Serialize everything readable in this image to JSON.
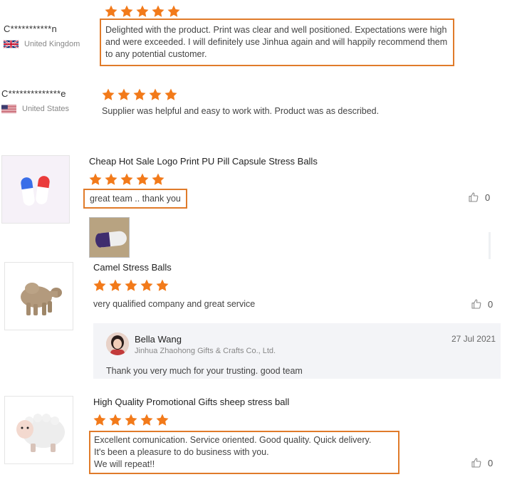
{
  "reviews": [
    {
      "reviewer": "C***********n",
      "country": "United Kingdom",
      "rating": 5,
      "comment": "Delighted with the product. Print was clear and well positioned. Expectations were high and were exceeded. I will definitely use Jinhua again and will happily recommend them to any potential customer."
    },
    {
      "reviewer": "C**************e",
      "country": "United States",
      "rating": 5,
      "comment": "Supplier was helpful and easy to work with. Product was as described."
    }
  ],
  "products": [
    {
      "title": "Cheap Hot Sale Logo Print PU Pill Capsule Stress Balls",
      "rating": 5,
      "comment": "great team .. thank you",
      "likes": "0"
    },
    {
      "title": "Camel Stress Balls",
      "rating": 5,
      "comment": "very qualified company and great service",
      "likes": "0",
      "reply": {
        "name": "Bella Wang",
        "company": "Jinhua Zhaohong Gifts & Crafts Co., Ltd.",
        "date": "27 Jul 2021",
        "text": "Thank you very much for your trusting.  good team"
      }
    },
    {
      "title": "High Quality Promotional Gifts sheep stress ball",
      "rating": 5,
      "comment_lines": [
        "Excellent comunication. Service oriented. Good quality. Quick delivery.",
        "It's been a pleasure to do business with you.",
        "We will repeat!!"
      ],
      "likes": "0"
    }
  ],
  "colors": {
    "star": "#f27a1a",
    "highlight_border": "#e07b2a",
    "reply_bg": "#f3f4f7"
  },
  "icons": [
    "star-icon",
    "flag-uk-icon",
    "flag-us-icon",
    "thumbs-up-icon",
    "avatar"
  ]
}
